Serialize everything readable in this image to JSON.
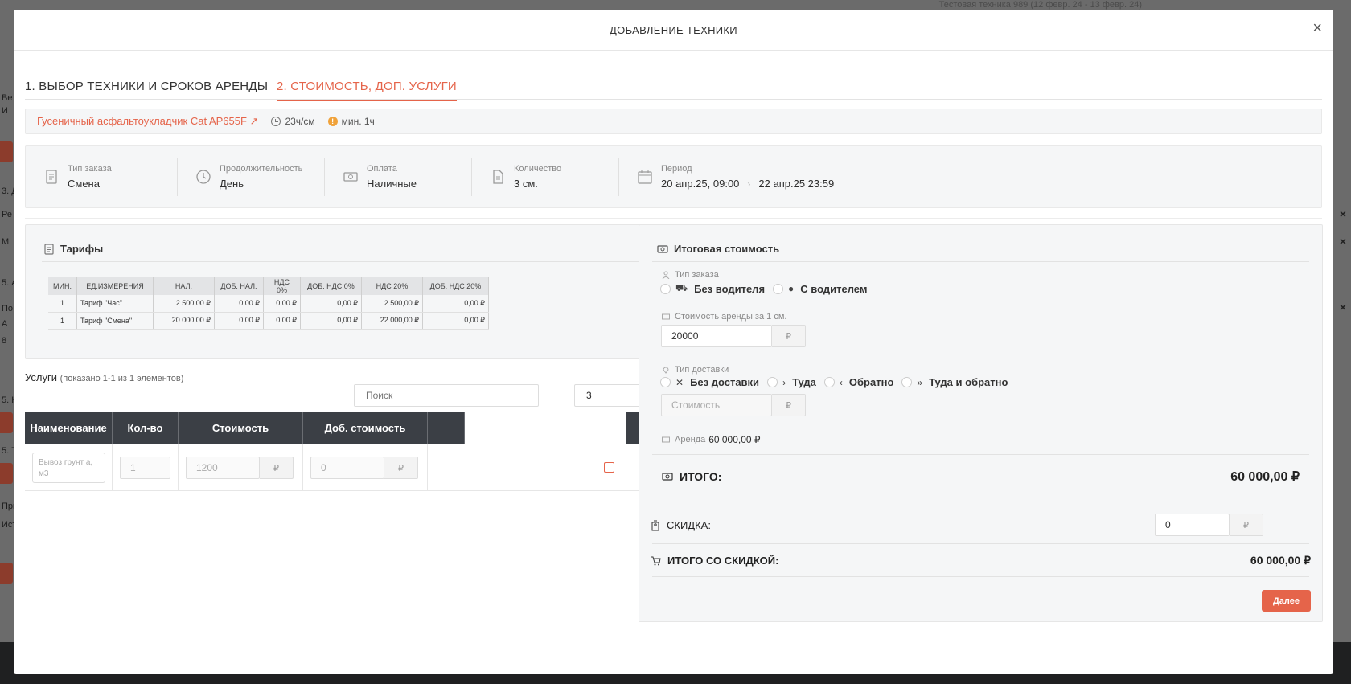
{
  "background": {
    "top_text": "Тестовая техника 989 (12 февр. 24 - 13 февр. 24)",
    "left_fragments": [
      "Ве",
      "И",
      "3. Д",
      "Ре",
      "М",
      "5. А",
      "По",
      "А",
      "8",
      "5. Н",
      "5. Т",
      "При",
      "Ист"
    ]
  },
  "modal": {
    "title": "ДОБАВЛЕНИЕ ТЕХНИКИ",
    "close_label": "×"
  },
  "tabs": [
    {
      "label": "1. ВЫБОР ТЕХНИКИ И СРОКОВ АРЕНДЫ"
    },
    {
      "label": "2. СТОИМОСТЬ, ДОП. УСЛУГИ"
    }
  ],
  "machine": {
    "name": "Гусеничный асфальтоукладчик Cat AP655F ↗",
    "hours": "23ч/см",
    "min": "мин. 1ч"
  },
  "info": {
    "order_type": {
      "label": "Тип заказа",
      "value": "Смена"
    },
    "duration": {
      "label": "Продолжительность",
      "value": "День"
    },
    "payment": {
      "label": "Оплата",
      "value": "Наличные"
    },
    "quantity": {
      "label": "Количество",
      "value": "3 см."
    },
    "period": {
      "label": "Период",
      "from": "20 апр.25, 09:00",
      "to": "22 апр.25 23:59"
    }
  },
  "tariffs": {
    "title": "Тарифы",
    "columns": [
      "МИН.",
      "ЕД.ИЗМЕРЕНИЯ",
      "НАЛ.",
      "ДОБ. НАЛ.",
      "НДС 0%",
      "ДОБ. НДС 0%",
      "НДС 20%",
      "ДОБ. НДС 20%"
    ],
    "rows": [
      [
        "1",
        "Тариф \"Час\"",
        "2 500,00 ₽",
        "0,00 ₽",
        "0,00 ₽",
        "0,00 ₽",
        "2 500,00 ₽",
        "0,00 ₽"
      ],
      [
        "1",
        "Тариф \"Смена\"",
        "20 000,00 ₽",
        "0,00 ₽",
        "0,00 ₽",
        "0,00 ₽",
        "22 000,00 ₽",
        "0,00 ₽"
      ]
    ]
  },
  "services": {
    "title": "Услуги",
    "shown": "(показано 1-1 из 1 элементов)",
    "search_placeholder": "Поиск",
    "page_size": "3",
    "headers": [
      "Наименование",
      "Кол-во",
      "Стоимость",
      "Доб. стоимость"
    ],
    "row": {
      "name_placeholder": "Вывоз грунт а, м3",
      "qty": "1",
      "price": "1200",
      "price_currency": "₽",
      "extra": "0",
      "extra_currency": "₽"
    }
  },
  "total": {
    "title": "Итоговая стоимость",
    "order_type_label": "Тип заказа",
    "order_type_options": [
      "Без водителя",
      "С водителем"
    ],
    "rent_price_label": "Стоимость аренды за 1 см.",
    "rent_price_value": "20000",
    "currency": "₽",
    "delivery_label": "Тип доставки",
    "delivery_options": [
      "Без доставки",
      "Туда",
      "Обратно",
      "Туда и обратно"
    ],
    "delivery_cost_placeholder": "Стоимость",
    "rent_label": "Аренда",
    "rent_value": "60 000,00 ₽",
    "itogo_label": "ИТОГО:",
    "itogo_value": "60 000,00 ₽",
    "discount_label": "СКИДКА:",
    "discount_value": "0",
    "total_discount_label": "ИТОГО СО СКИДКОЙ:",
    "total_discount_value": "60 000,00 ₽",
    "next_label": "Далее"
  },
  "colors": {
    "accent": "#e5644a",
    "table_head": "#3b3f45",
    "panel": "#f5f6f7"
  }
}
